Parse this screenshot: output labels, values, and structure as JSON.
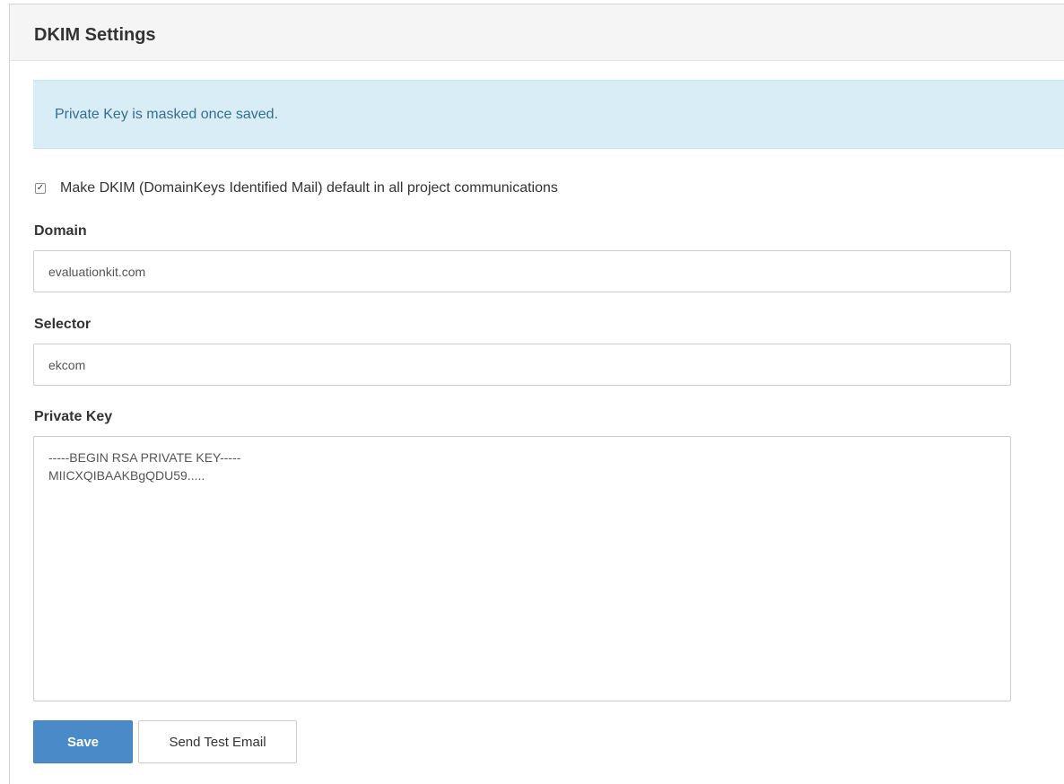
{
  "panel": {
    "title": "DKIM Settings"
  },
  "alert": {
    "text": "Private Key is masked once saved."
  },
  "default_checkbox": {
    "checked": true,
    "label": "Make DKIM (DomainKeys Identified Mail) default in all project communications"
  },
  "fields": {
    "domain": {
      "label": "Domain",
      "value": "evaluationkit.com"
    },
    "selector": {
      "label": "Selector",
      "value": "ekcom"
    },
    "private_key": {
      "label": "Private Key",
      "value": "-----BEGIN RSA PRIVATE KEY-----\nMIICXQIBAAKBgQDU59....."
    }
  },
  "buttons": {
    "save_label": "Save",
    "send_test_label": "Send Test Email"
  },
  "colors": {
    "primary": "#4a8ac9",
    "alert_bg": "#d9edf7",
    "alert_text": "#31708f",
    "heading_bg": "#f5f5f5"
  },
  "icons": {
    "checkbox": "check-icon"
  }
}
